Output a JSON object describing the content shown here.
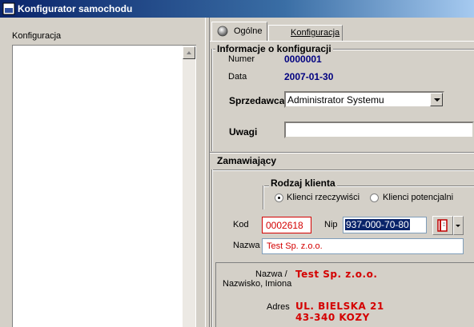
{
  "window": {
    "title": "Konfigurator samochodu",
    "icon_text": "DME"
  },
  "left": {
    "label": "Konfiguracja"
  },
  "tabs": [
    {
      "label": "Ogólne"
    },
    {
      "label": "Konfiguracja"
    }
  ],
  "info": {
    "title": "Informacje o konfiguracji",
    "numer_label": "Numer",
    "numer_value": "0000001",
    "data_label": "Data",
    "data_value": "2007-01-30",
    "sprzedawca_label": "Sprzedawca",
    "sprzedawca_value": "Administrator Systemu",
    "uwagi_label": "Uwagi",
    "uwagi_value": ""
  },
  "zamawiajacy": {
    "title": "Zamawiający",
    "rodzaj_title": "Rodzaj klienta",
    "radio_real": "Klienci rzeczywiści",
    "radio_potential": "Klienci potencjalni",
    "kod_label": "Kod",
    "kod_value": "0002618",
    "nip_label": "Nip",
    "nip_value": "937-000-70-80",
    "nazwa_label": "Nazwa",
    "nazwa_value": "Test Sp. z.o.o.",
    "detail_nazwa_label1": "Nazwa /",
    "detail_nazwa_label2": "Nazwisko, Imiona",
    "detail_nazwa_value": "Test Sp. z.o.o.",
    "detail_adres_label": "Adres",
    "detail_adres_line1": "UL. BIELSKA 21",
    "detail_adres_line2": "43-340 KOZY"
  },
  "colors": {
    "accent": "#0a246a",
    "value_blue": "#000080",
    "red": "#d40000"
  }
}
